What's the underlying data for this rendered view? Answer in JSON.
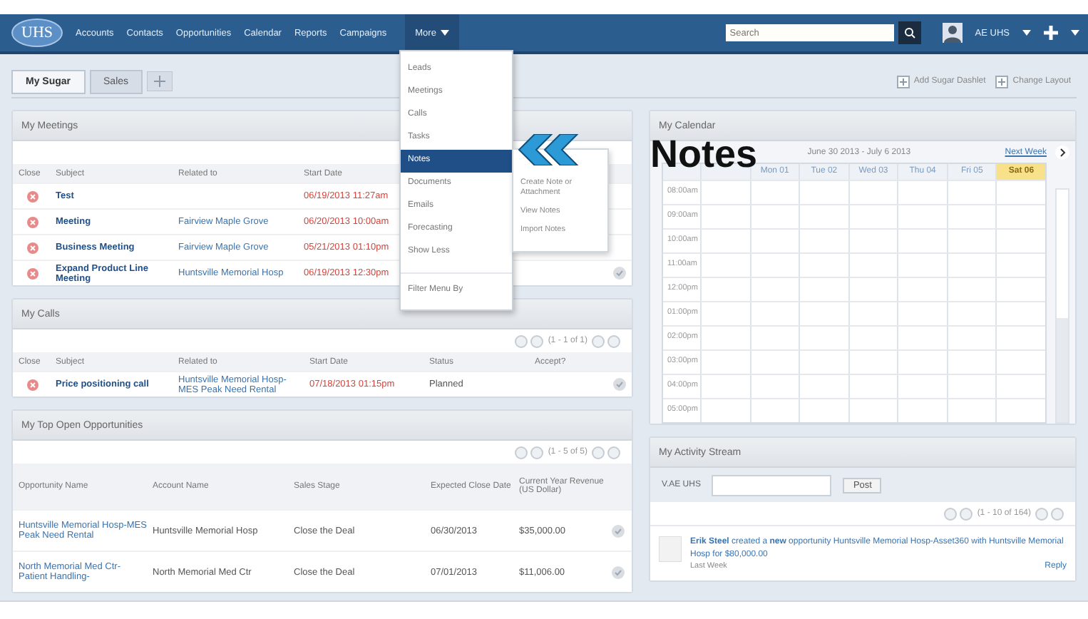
{
  "nav": {
    "logo": "UHS",
    "items": [
      "Accounts",
      "Contacts",
      "Opportunities",
      "Calendar",
      "Reports",
      "Campaigns"
    ],
    "more": "More",
    "search": {
      "placeholder": "Search"
    },
    "user": "AE UHS"
  },
  "dashboard_tabs": [
    {
      "label": "My Sugar",
      "selected": true
    },
    {
      "label": "Sales",
      "selected": false
    }
  ],
  "dashboard_actions": [
    "Add Sugar Dashlet",
    "Change Layout"
  ],
  "more_menu": {
    "items": [
      {
        "label": "Leads",
        "selected": false
      },
      {
        "label": "Meetings",
        "selected": false
      },
      {
        "label": "Calls",
        "selected": false
      },
      {
        "label": "Tasks",
        "selected": false
      },
      {
        "label": "Notes",
        "selected": true
      },
      {
        "label": "Documents",
        "selected": false
      },
      {
        "label": "Emails",
        "selected": false
      },
      {
        "label": "Forecasting",
        "selected": false
      },
      {
        "label": "Show Less",
        "selected": false
      }
    ],
    "footer": "Filter Menu By"
  },
  "submenu": [
    "Create Note or Attachment",
    "View Notes",
    "Import Notes"
  ],
  "callout": "Notes",
  "meetings": {
    "title": "My Meetings",
    "columns": [
      "Close",
      "Subject",
      "Related to",
      "Start Date"
    ],
    "rows": [
      {
        "subject": "Test",
        "date": "06/19/2013 11:27am"
      },
      {
        "subject": "Meeting",
        "related": "Fairview Maple Grove",
        "date": "06/20/2013 10:00am"
      },
      {
        "subject": "Business Meeting",
        "related": "Fairview Maple Grove",
        "date": "05/21/2013 01:10pm"
      },
      {
        "subject": "Expand Product Line Meeting",
        "related": "Huntsville Memorial Hosp",
        "date": "06/19/2013 12:30pm"
      }
    ]
  },
  "calls": {
    "title": "My Calls",
    "pager": "(1 - 1 of 1)",
    "columns": [
      "Close",
      "Subject",
      "Related to",
      "Start Date",
      "Status",
      "Accept?"
    ],
    "rows": [
      {
        "subject": "Price positioning call",
        "related": "Huntsville Memorial Hosp-MES Peak Need Rental",
        "date": "07/18/2013 01:15pm",
        "status": "Planned"
      }
    ]
  },
  "opportunities": {
    "title": "My Top Open Opportunities",
    "pager": "(1 - 5 of 5)",
    "columns": [
      "Opportunity Name",
      "Account Name",
      "Sales Stage",
      "Expected Close Date",
      "Current Year Revenue (US Dollar)"
    ],
    "rows": [
      {
        "name": "Huntsville Memorial Hosp-MES Peak Need Rental",
        "account": "Huntsville Memorial Hosp",
        "stage": "Close the Deal",
        "date": "06/30/2013",
        "revenue": "$35,000.00"
      },
      {
        "name": "North Memorial Med Ctr-Patient Handling-",
        "account": "North Memorial Med Ctr",
        "stage": "Close the Deal",
        "date": "07/01/2013",
        "revenue": "$11,006.00"
      }
    ]
  },
  "calendar": {
    "title": "My Calendar",
    "range": "June 30 2013 - July 6 2013",
    "next": "Next Week",
    "days": [
      {
        "label": "Mon 01",
        "selected": false
      },
      {
        "label": "Tue 02",
        "selected": false
      },
      {
        "label": "Wed 03",
        "selected": false
      },
      {
        "label": "Thu 04",
        "selected": false
      },
      {
        "label": "Fri 05",
        "selected": false
      },
      {
        "label": "Sat 06",
        "selected": true
      }
    ],
    "times": [
      "08:00am",
      "09:00am",
      "10:00am",
      "11:00am",
      "12:00pm",
      "01:00pm",
      "02:00pm",
      "03:00pm",
      "04:00pm",
      "05:00pm"
    ]
  },
  "activity": {
    "title": "My Activity Stream",
    "user": "V.AE UHS",
    "post": "Post",
    "pager": "(1 - 10 of 164)",
    "entry": "**Erik Steel** created a **new** opportunity Huntsville Memorial Hosp-Asset360 with Huntsville Memorial Hosp for $80,000.00",
    "time": "Last Week",
    "reply": "Reply"
  }
}
